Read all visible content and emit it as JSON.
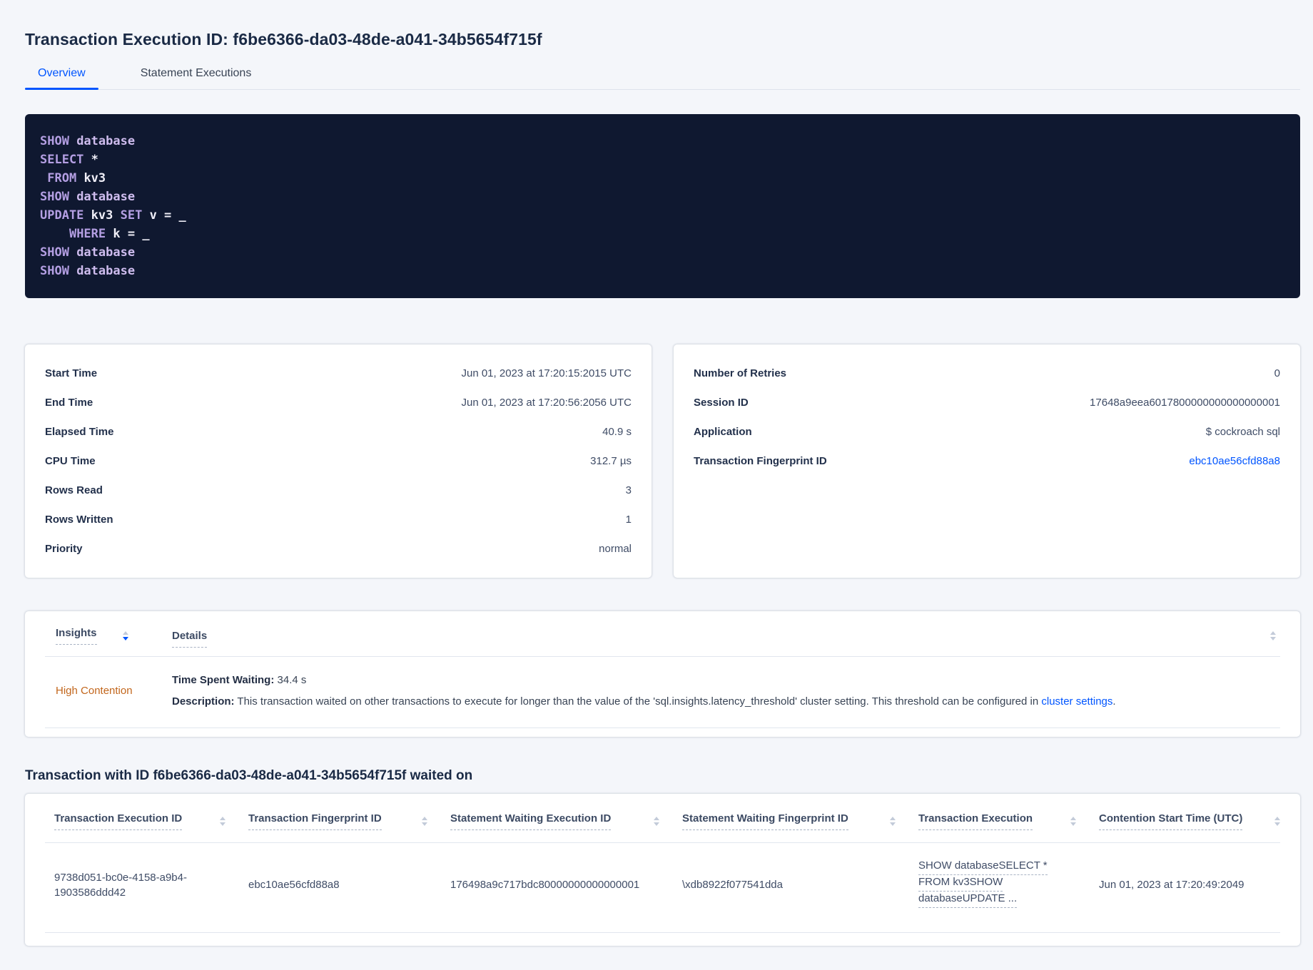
{
  "page": {
    "title": "Transaction Execution ID: f6be6366-da03-48de-a041-34b5654f715f",
    "tabs": {
      "overview": "Overview",
      "statement_executions": "Statement Executions"
    }
  },
  "sql": {
    "lines": [
      [
        {
          "c": "tok-kw",
          "t": "SHOW "
        },
        {
          "c": "tok-db",
          "t": "database"
        }
      ],
      [
        {
          "c": "tok-kw",
          "t": "SELECT "
        },
        {
          "c": "tok-pl",
          "t": "*"
        }
      ],
      [
        {
          "c": "tok-pl",
          "t": " "
        },
        {
          "c": "tok-kw",
          "t": "FROM "
        },
        {
          "c": "tok-pl",
          "t": "kv3"
        }
      ],
      [
        {
          "c": "tok-kw",
          "t": "SHOW "
        },
        {
          "c": "tok-db",
          "t": "database"
        }
      ],
      [
        {
          "c": "tok-kw",
          "t": "UPDATE "
        },
        {
          "c": "tok-pl",
          "t": "kv3 "
        },
        {
          "c": "tok-kw",
          "t": "SET "
        },
        {
          "c": "tok-pl",
          "t": "v = _"
        }
      ],
      [
        {
          "c": "tok-pl",
          "t": "    "
        },
        {
          "c": "tok-kw",
          "t": "WHERE "
        },
        {
          "c": "tok-pl",
          "t": "k = _"
        }
      ],
      [
        {
          "c": "tok-kw",
          "t": "SHOW "
        },
        {
          "c": "tok-db",
          "t": "database"
        }
      ],
      [
        {
          "c": "tok-kw",
          "t": "SHOW "
        },
        {
          "c": "tok-db",
          "t": "database"
        }
      ]
    ]
  },
  "summary_left": {
    "rows": [
      {
        "label": "Start Time",
        "value": "Jun 01, 2023 at 17:20:15:2015 UTC"
      },
      {
        "label": "End Time",
        "value": "Jun 01, 2023 at 17:20:56:2056 UTC"
      },
      {
        "label": "Elapsed Time",
        "value": "40.9 s"
      },
      {
        "label": "CPU Time",
        "value": "312.7 µs"
      },
      {
        "label": "Rows Read",
        "value": "3"
      },
      {
        "label": "Rows Written",
        "value": "1"
      },
      {
        "label": "Priority",
        "value": "normal"
      }
    ]
  },
  "summary_right": {
    "rows": [
      {
        "label": "Number of Retries",
        "value": "0"
      },
      {
        "label": "Session ID",
        "value": "17648a9eea6017800000000000000001"
      },
      {
        "label": "Application",
        "value": "$ cockroach sql"
      }
    ],
    "fingerprint_label": "Transaction Fingerprint ID",
    "fingerprint_value": "ebc10ae56cfd88a8"
  },
  "insights": {
    "col_insights": "Insights",
    "col_details": "Details",
    "row": {
      "insight": "High Contention",
      "waiting_label": "Time Spent Waiting:",
      "waiting_value": " 34.4 s",
      "desc_label": "Description:",
      "desc_text": " This transaction waited on other transactions to execute for longer than the value of the 'sql.insights.latency_threshold' cluster setting. This threshold can be configured in ",
      "desc_link": "cluster settings",
      "desc_end": "."
    }
  },
  "waited": {
    "heading": "Transaction with ID f6be6366-da03-48de-a041-34b5654f715f waited on",
    "columns": [
      "Transaction Execution ID",
      "Transaction Fingerprint ID",
      "Statement Waiting Execution ID",
      "Statement Waiting Fingerprint ID",
      "Transaction Execution",
      "Contention Start Time (UTC)"
    ],
    "row": {
      "txn_execution_id": "9738d051-bc0e-4158-a9b4-1903586ddd42",
      "txn_fingerprint_id": "ebc10ae56cfd88a8",
      "stmt_waiting_execution_id": "176498a9c717bdc80000000000000001",
      "stmt_waiting_fingerprint_id": "\\xdb8922f077541dda",
      "exec_lines": [
        "SHOW databaseSELECT *",
        "FROM kv3SHOW",
        "databaseUPDATE ..."
      ],
      "contention_start": "Jun 01, 2023 at 17:20:49:2049"
    }
  },
  "colors": {
    "accent_blue": "#0055ff",
    "warning_orange": "#c2661c",
    "sql_box_bg": "#0f1830",
    "page_bg": "#f4f6fa"
  }
}
